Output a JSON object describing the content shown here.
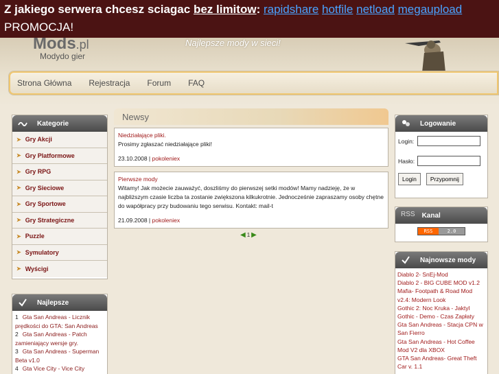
{
  "ad": {
    "prefix": "Z jakiego serwera chcesz sciagac ",
    "underlined": "bez limitow",
    "colon": ": ",
    "links": [
      "rapidshare",
      "hotfile",
      "netload",
      "megaupload"
    ],
    "line2": "PROMOCJA!"
  },
  "header": {
    "logo": "Mods",
    "logo_suffix": ".pl",
    "logo_sub": "Modydo gier",
    "slogan": "Najlepsze mody w sieci!"
  },
  "nav": [
    "Strona Główna",
    "Rejestracja",
    "Forum",
    "FAQ"
  ],
  "categories": {
    "title": "Kategorie",
    "items": [
      "Gry Akcji",
      "Gry Platformowe",
      "Gry RPG",
      "Gry Sieciowe",
      "Gry Sportowe",
      "Gry Strategiczne",
      "Puzzle",
      "Symulatory",
      "Wyścigi"
    ]
  },
  "best": {
    "title": "Najlepsze",
    "items": [
      {
        "num": "1",
        "text": "Gta San Andreas - Licznik prędkości do GTA: San Andreas"
      },
      {
        "num": "2",
        "text": "Gta San Andreas - Patch zamieniający wersje gry."
      },
      {
        "num": "3",
        "text": "Gta San Andreas - Superman Beta v1.0"
      },
      {
        "num": "4",
        "text": "Gta Vice City - Vice City"
      }
    ]
  },
  "news": {
    "title": "Newsy",
    "items": [
      {
        "title": "Niedziałające pliki.",
        "body": "Prosimy zgłaszać niedziałające pliki!",
        "date": "23.10.2008",
        "author": "pokoleniex"
      },
      {
        "title": "Pierwsze mody",
        "body": "Witamy! Jak możecie zauważyć, doszliśmy do pierwszej setki modów! Mamy nadzieję, że w najbliższym czasie liczba ta zostanie zwiększona kilkukrotnie. Jednocześnie zapraszamy osoby chętne do wapółpracy przy budowaniu tego serwisu. Kontakt: mail-t",
        "date": "21.09.2008",
        "author": "pokoleniex"
      }
    ],
    "page": "1"
  },
  "login": {
    "title": "Logowanie",
    "login_label": "Login:",
    "pass_label": "Hasło:",
    "login_button": "Login",
    "remind_button": "Przypomnij"
  },
  "rss": {
    "title": "Kanal",
    "badge_left": "RSS",
    "badge_right": "2.0"
  },
  "newest": {
    "title": "Najnowsze mody",
    "items": [
      "Diablo 2- SnEj-Mod",
      "Diablo 2 - BIG CUBE MOD v1.2",
      "Mafia- Footpath & Road Mod v2.4: Modern Look",
      "Gothic 2: Noc Kruka - Jaktyl",
      "Gothic - Demo - Czas Zapłaty",
      "Gta San Andreas - Stacja CPN w San Fierro",
      "Gta San Andreas - Hot Coffee Mod V2 dla XBOX",
      "GTA San Andreas- Great Theft Car v. 1.1"
    ]
  },
  "colors": {
    "ad_bg": "#4b1313",
    "ad_link": "#4aa3ff",
    "link_red": "#a01a1a",
    "panel_head": "#5a5a5a"
  }
}
